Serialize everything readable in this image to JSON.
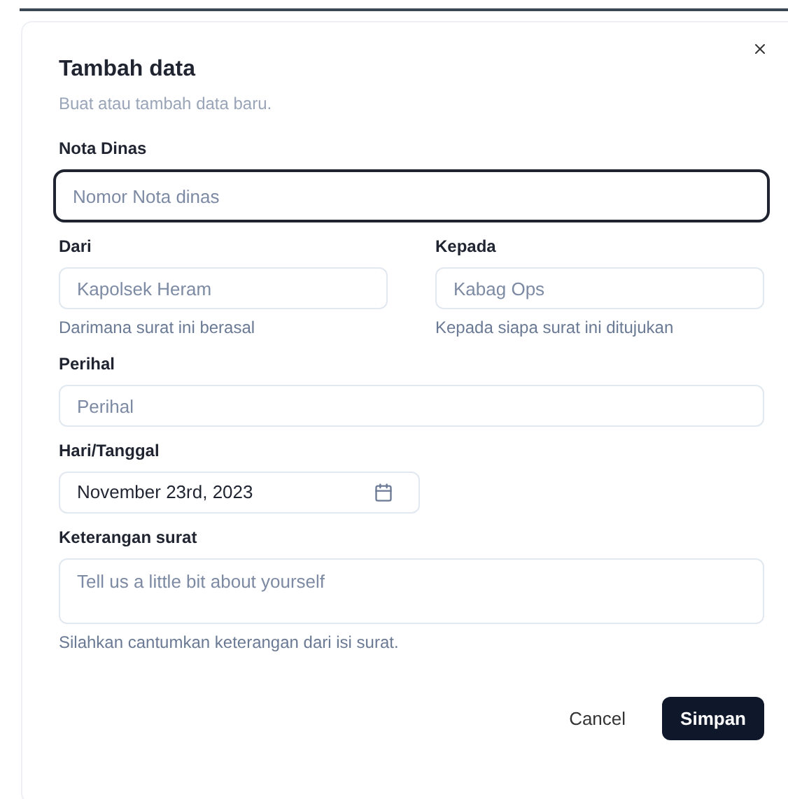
{
  "dialog": {
    "title": "Tambah data",
    "description": "Buat atau tambah data baru."
  },
  "fields": [
    {
      "kind": "input",
      "label": "Nota Dinas",
      "placeholder": "Nomor Nota dinas",
      "focused": true
    },
    {
      "kind": "pair",
      "items": [
        {
          "kind": "input",
          "label": "Dari",
          "placeholder": "Kapolsek Heram",
          "hint": "Darimana surat ini berasal",
          "focused": false
        },
        {
          "kind": "input",
          "label": "Kepada",
          "placeholder": "Kabag Ops",
          "hint": "Kepada siapa surat ini ditujukan",
          "focused": false
        }
      ]
    },
    {
      "kind": "input",
      "label": "Perihal",
      "placeholder": "Perihal",
      "focused": false
    },
    {
      "kind": "date",
      "label": "Hari/Tanggal",
      "value": "November 23rd, 2023"
    },
    {
      "kind": "textarea",
      "label": "Keterangan surat",
      "placeholder": "Tell us a little bit about yourself",
      "hint": "Silahkan cantumkan keterangan dari isi surat."
    }
  ],
  "buttons": [
    {
      "label": "Cancel",
      "kind": "ghost"
    },
    {
      "label": "Simpan",
      "kind": "primary"
    }
  ]
}
